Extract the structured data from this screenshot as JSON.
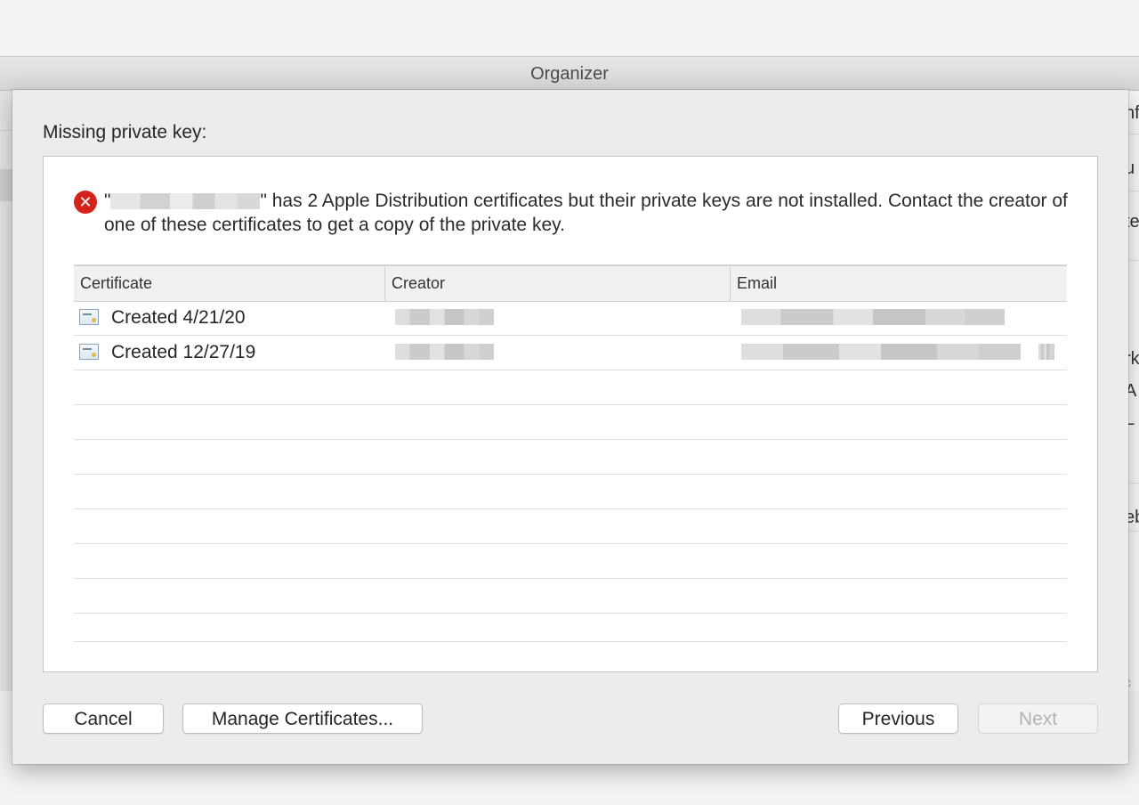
{
  "window": {
    "title": "Organizer",
    "right_fragments": [
      "nf",
      "u",
      "te",
      "rk",
      "A",
      "L",
      "eb",
      "c"
    ]
  },
  "sheet": {
    "heading": "Missing private key:",
    "message": {
      "open_quote": "\"",
      "close_and_text": "\" has 2 Apple Distribution certificates but their private keys are not installed. Contact the creator of one of these certificates to get a copy of the private key.",
      "icon": "error-icon",
      "icon_glyph": "✕"
    },
    "table": {
      "headers": {
        "certificate": "Certificate",
        "creator": "Creator",
        "email": "Email"
      },
      "rows": [
        {
          "certificate": "Created 4/21/20"
        },
        {
          "certificate": "Created 12/27/19"
        }
      ]
    },
    "buttons": {
      "cancel": "Cancel",
      "manage": "Manage Certificates...",
      "previous": "Previous",
      "next": "Next"
    }
  },
  "colors": {
    "error": "#d4231b",
    "sheet_bg": "#ececed",
    "disabled_text": "#b3b3b3"
  }
}
